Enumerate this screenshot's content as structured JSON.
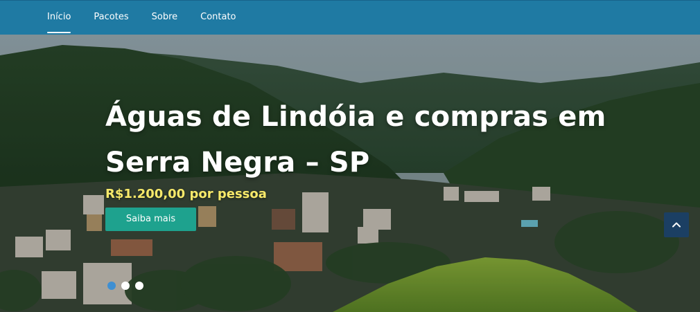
{
  "nav": {
    "items": [
      {
        "label": "Início",
        "active": true
      },
      {
        "label": "Pacotes",
        "active": false
      },
      {
        "label": "Sobre",
        "active": false
      },
      {
        "label": "Contato",
        "active": false
      }
    ]
  },
  "hero": {
    "title_line1": "Águas de Lindóia e compras em",
    "title_line2": "Serra Negra – SP",
    "price": "R$1.200,00 por pessoa",
    "button_label": "Saiba mais",
    "image_subject": "mountain-town-aerial-photo"
  },
  "carousel": {
    "slide_count": 3,
    "active_index": 0
  },
  "controls": {
    "back_to_top_icon": "chevron-up-icon"
  },
  "colors": {
    "navbar": "#1f7aa3",
    "button": "#1ea28e",
    "price_text": "#f7e96a",
    "active_dot": "#3f8fd2",
    "back_to_top": "#1b3f63"
  }
}
